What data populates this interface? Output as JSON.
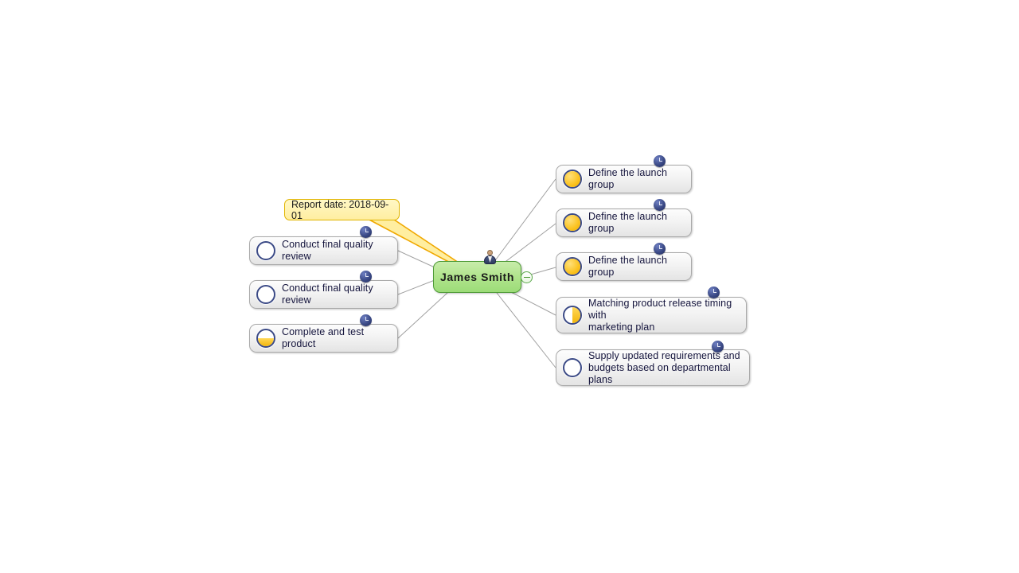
{
  "app": {
    "type": "mind-map",
    "background": "#ffffff"
  },
  "center": {
    "label": "James Smith",
    "fill": "#b0e48c",
    "border": "#4f9b37",
    "avatar_icon": "person-icon",
    "collapse_icon": "minus-circle-icon",
    "collapse_state": "expanded"
  },
  "callout": {
    "text": "Report date: 2018-09-01",
    "fill": "#ffeea0",
    "border": "#e0b400"
  },
  "legend": {
    "clock_badge": "clock-icon",
    "progress_icon": "progress-pie-icon"
  },
  "branches": {
    "left": [
      {
        "label": "Conduct final quality review",
        "progress": 0,
        "progress_class": "p0",
        "clock": true
      },
      {
        "label": "Conduct final quality review",
        "progress": 0,
        "progress_class": "p0",
        "clock": true
      },
      {
        "label": "Complete and test product",
        "progress": 25,
        "progress_class": "p25",
        "clock": true
      }
    ],
    "right": [
      {
        "label": "Define the launch group",
        "progress": 100,
        "progress_class": "p100",
        "clock": true
      },
      {
        "label": "Define the launch group",
        "progress": 100,
        "progress_class": "p100",
        "clock": true
      },
      {
        "label": "Define the launch group",
        "progress": 100,
        "progress_class": "p100",
        "clock": true
      },
      {
        "label": "Matching product release timing with\nmarketing plan",
        "progress": 50,
        "progress_class": "p50r",
        "clock": true
      },
      {
        "label": "Supply updated requirements and\nbudgets based on departmental plans",
        "progress": 0,
        "progress_class": "p0",
        "clock": true
      }
    ]
  },
  "colors": {
    "node_border": "#a9a9a9",
    "node_fill": "#f0f0f0",
    "edge": "#a0a0a0",
    "badge": "#3b4a86",
    "progress_fill": "#fbc02d",
    "text": "#14143c"
  }
}
